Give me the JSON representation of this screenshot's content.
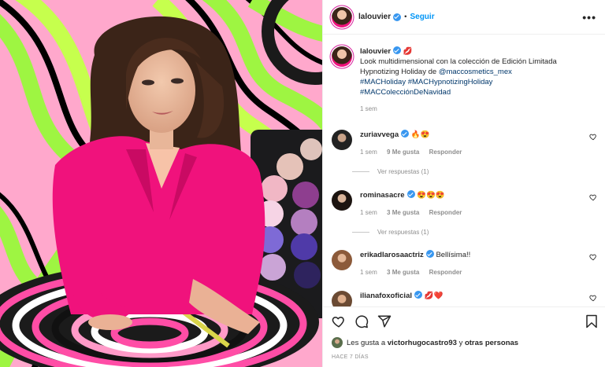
{
  "post": {
    "username": "lalouvier",
    "follow_label": "Seguir",
    "more_label": "•••",
    "caption_emoji": "💋",
    "caption_text": "Look multidimensional con la colección de Edición Limitada Hypnotizing Holiday de ",
    "caption_mention": "@maccosmetics_mex",
    "caption_hashtags": "#MACHoliday #MACHypnotizingHoliday #MACColecciónDeNavidad",
    "caption_time": "1 sem"
  },
  "comments": [
    {
      "username": "zuriavvega",
      "text": "🔥😍",
      "time": "1 sem",
      "likes": "9 Me gusta",
      "reply": "Responder",
      "replies": "Ver respuestas (1)"
    },
    {
      "username": "rominasacre",
      "text": "😍😍😍",
      "time": "1 sem",
      "likes": "3 Me gusta",
      "reply": "Responder",
      "replies": "Ver respuestas (1)"
    },
    {
      "username": "erikadlarosaactriz",
      "text": "Bellísima!!",
      "time": "1 sem",
      "likes": "3 Me gusta",
      "reply": "Responder"
    },
    {
      "username": "ilianafoxoficial",
      "text": "💋❤️"
    }
  ],
  "footer": {
    "likes_prefix": "Les gusta a ",
    "likes_user": "victorhugocastro93",
    "likes_mid": " y ",
    "likes_others": "otras personas",
    "ago": "HACE 7 DÍAS"
  },
  "colors": {
    "accent": "#0095f6",
    "verified": "#3897f0",
    "muted": "#8e8e8e",
    "text": "#262626"
  },
  "icons": [
    "heart-icon",
    "comment-icon",
    "share-icon",
    "bookmark-icon",
    "verified-icon",
    "more-options-icon"
  ]
}
